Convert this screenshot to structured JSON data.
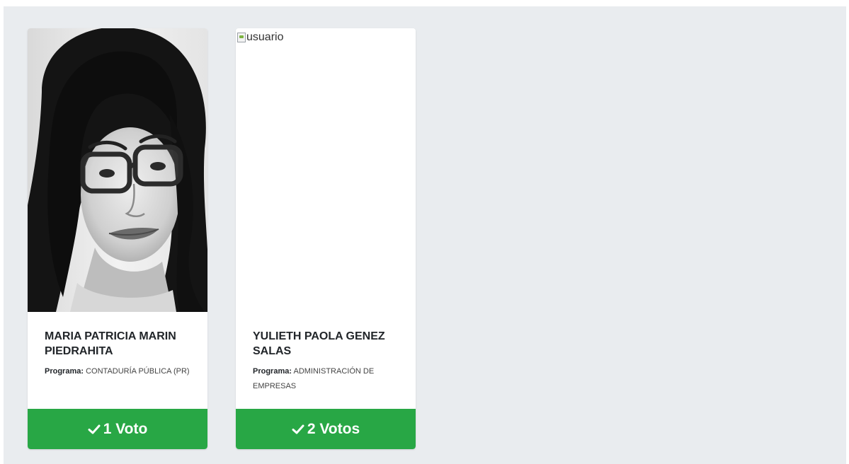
{
  "candidates": [
    {
      "name": "MARIA PATRICIA MARIN PIEDRAHITA",
      "program_label": "Programa:",
      "program": "CONTADURÍA PÚBLICA (PR)",
      "vote_label": "1 Voto",
      "photo_alt": "usuario",
      "photo_loaded": true
    },
    {
      "name": "YULIETH PAOLA GENEZ SALAS",
      "program_label": "Programa:",
      "program": "ADMINISTRACIÓN DE EMPRESAS",
      "vote_label": "2 Votos",
      "photo_alt": "usuario",
      "photo_loaded": false
    }
  ],
  "colors": {
    "vote_button": "#28a745",
    "background_panel": "#e9ecef"
  },
  "icons": {
    "vote": "check-icon",
    "broken_image": "broken-image-icon"
  }
}
